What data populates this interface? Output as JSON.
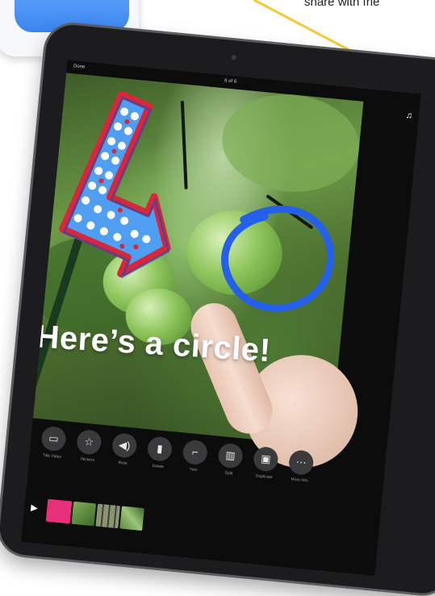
{
  "caption": "share with frie",
  "screen": {
    "done_label": "Done",
    "counter": "6 of 6",
    "music_icon": "music-note-icon"
  },
  "photo_text": "Here’s a circle!",
  "toolbar": {
    "items": [
      {
        "icon": "text-icon",
        "glyph": "▭",
        "label": "Title Video"
      },
      {
        "icon": "sticker-icon",
        "glyph": "☆",
        "label": "Stickers"
      },
      {
        "icon": "volume-icon",
        "glyph": "◀)",
        "label": "Mute"
      },
      {
        "icon": "trash-icon",
        "glyph": "▮",
        "label": "Delete"
      },
      {
        "icon": "crop-icon",
        "glyph": "⌐",
        "label": "Trim"
      },
      {
        "icon": "split-icon",
        "glyph": "▥",
        "label": "Split"
      },
      {
        "icon": "duplicate-icon",
        "glyph": "▣",
        "label": "Duplicate"
      },
      {
        "icon": "more-icon",
        "glyph": "⋯",
        "label": "More Info"
      }
    ]
  },
  "timeline": {
    "play_icon": "play-icon",
    "clips": [
      {
        "color": "#e8307a",
        "label": "clip-1"
      },
      {
        "color": "#5f8a40",
        "label": "clip-2"
      },
      {
        "color": "#6f7a5c",
        "label": "clip-3"
      },
      {
        "color": "#4d7a36",
        "label": "clip-4"
      }
    ]
  },
  "colors": {
    "pointer": "#f6c833",
    "arrow_fill": "#4f9ef2",
    "arrow_outline": "#d8263a",
    "circle_stroke": "#2561e8",
    "app_icon": "#4a90f0"
  }
}
